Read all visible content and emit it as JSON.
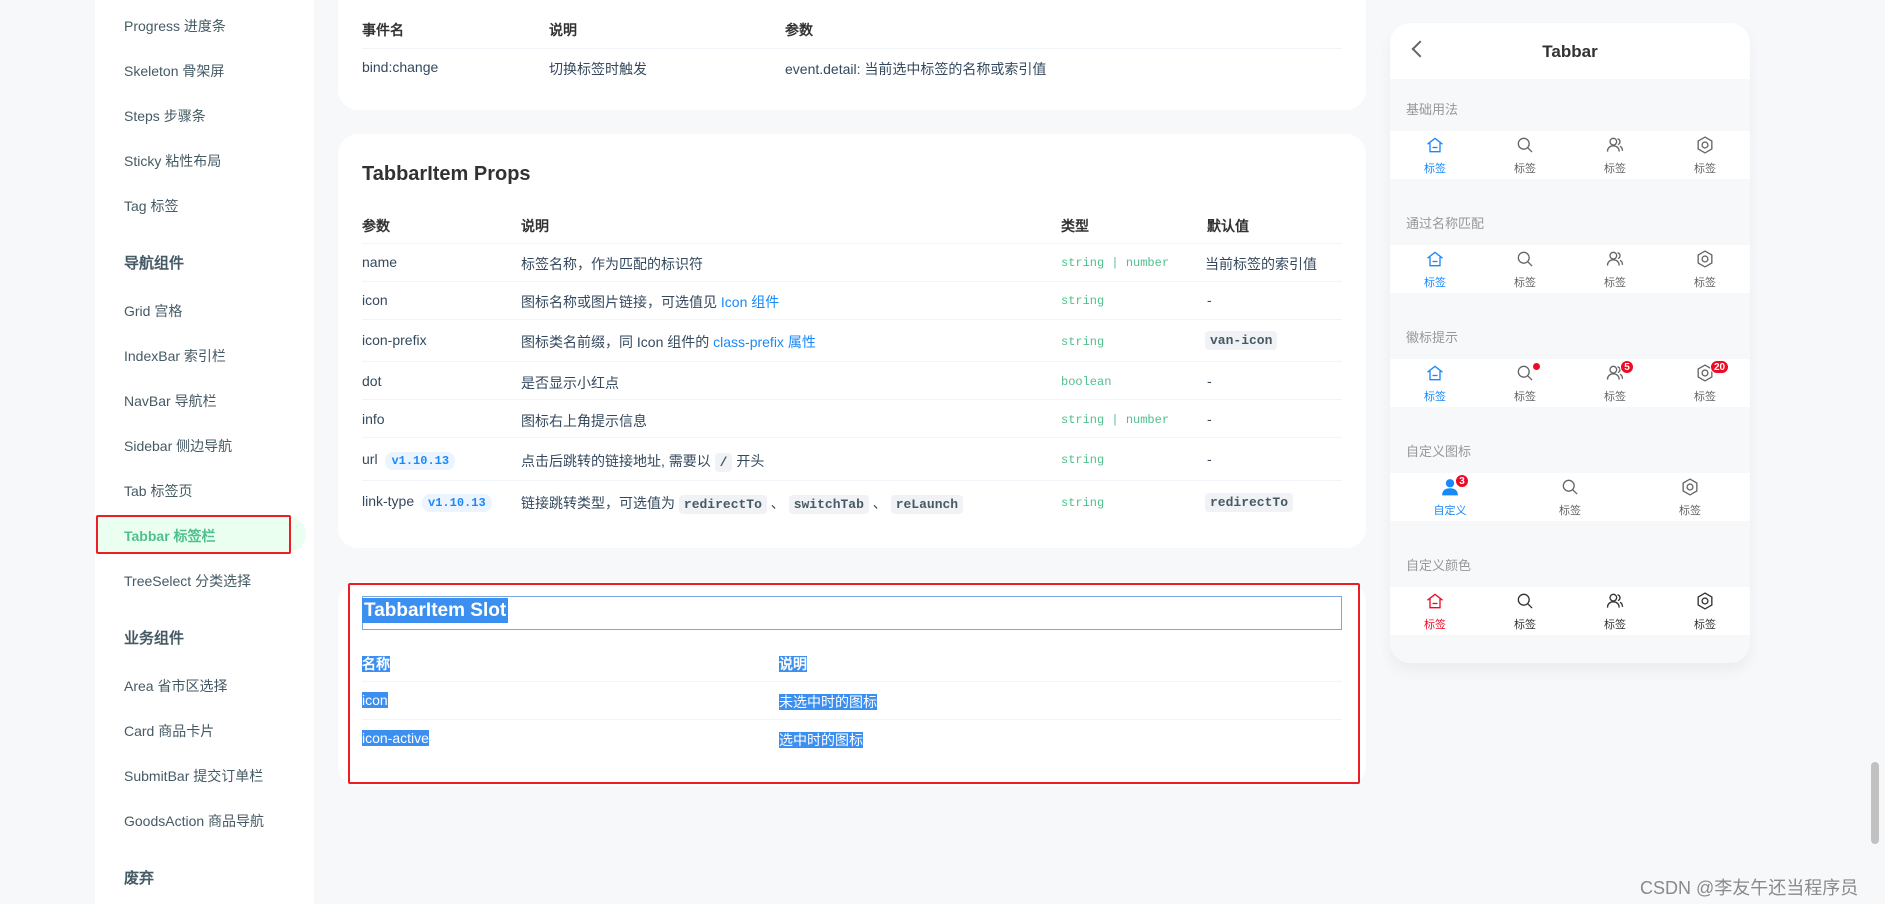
{
  "sidebar": {
    "items_top": [
      {
        "label": "Progress 进度条"
      },
      {
        "label": "Skeleton 骨架屏"
      },
      {
        "label": "Steps 步骤条"
      },
      {
        "label": "Sticky 粘性布局"
      },
      {
        "label": "Tag 标签"
      }
    ],
    "group_nav": "导航组件",
    "items_nav": [
      {
        "label": "Grid 宫格"
      },
      {
        "label": "IndexBar 索引栏"
      },
      {
        "label": "NavBar 导航栏"
      },
      {
        "label": "Sidebar 侧边导航"
      },
      {
        "label": "Tab 标签页"
      },
      {
        "label": "Tabbar 标签栏"
      },
      {
        "label": "TreeSelect 分类选择"
      }
    ],
    "group_biz": "业务组件",
    "items_biz": [
      {
        "label": "Area 省市区选择"
      },
      {
        "label": "Card 商品卡片"
      },
      {
        "label": "SubmitBar 提交订单栏"
      },
      {
        "label": "GoodsAction 商品导航"
      }
    ],
    "group_deprecated": "废弃"
  },
  "events_table": {
    "headers": [
      "事件名",
      "说明",
      "参数"
    ],
    "rows": [
      [
        "bind:change",
        "切换标签时触发",
        "event.detail: 当前选中标签的名称或索引值"
      ]
    ]
  },
  "props": {
    "title": "TabbarItem Props",
    "headers": [
      "参数",
      "说明",
      "类型",
      "默认值"
    ],
    "rows": {
      "name": {
        "param": "name",
        "desc": "标签名称，作为匹配的标识符",
        "type1": "string",
        "sep": "|",
        "type2": "number",
        "default": "当前标签的索引值"
      },
      "icon": {
        "param": "icon",
        "desc": "图标名称或图片链接，可选值见 ",
        "link": "Icon 组件",
        "type1": "string",
        "default": "-"
      },
      "icon_prefix": {
        "param": "icon-prefix",
        "desc": "图标类名前缀，同 Icon 组件的 ",
        "link": "class-prefix 属性",
        "type1": "string",
        "default": "van-icon"
      },
      "dot": {
        "param": "dot",
        "desc": "是否显示小红点",
        "type1": "boolean",
        "default": "-"
      },
      "info": {
        "param": "info",
        "desc": "图标右上角提示信息",
        "type1": "string",
        "sep": "|",
        "type2": "number",
        "default": "-"
      },
      "url": {
        "param": "url",
        "version": "v1.10.13",
        "desc": "点击后跳转的链接地址, 需要以 ",
        "code": "/",
        "desc2": " 开头",
        "type1": "string",
        "default": "-"
      },
      "link_type": {
        "param": "link-type",
        "version": "v1.10.13",
        "desc": "链接跳转类型，可选值为 ",
        "opt1": "redirectTo",
        "sep_cn": "、",
        "opt2": "switchTab",
        "opt3": "reLaunch",
        "type1": "string",
        "default": "redirectTo"
      }
    }
  },
  "slot": {
    "title": "TabbarItem Slot",
    "headers": [
      "名称",
      "说明"
    ],
    "rows": [
      [
        "icon",
        "未选中时的图标"
      ],
      [
        "icon-active",
        "选中时的图标"
      ]
    ]
  },
  "simulator": {
    "title": "Tabbar",
    "tab_label": "标签",
    "custom_label": "自定义",
    "sections": [
      "基础用法",
      "通过名称匹配",
      "徽标提示",
      "自定义图标",
      "自定义颜色"
    ],
    "badges": {
      "info5": "5",
      "info20": "20",
      "custom3": "3"
    },
    "colors": {
      "active": "#1989fa",
      "custom_active": "#ee0a24",
      "accent": "#4fc08d"
    }
  },
  "watermark": "CSDN @李友午还当程序员"
}
